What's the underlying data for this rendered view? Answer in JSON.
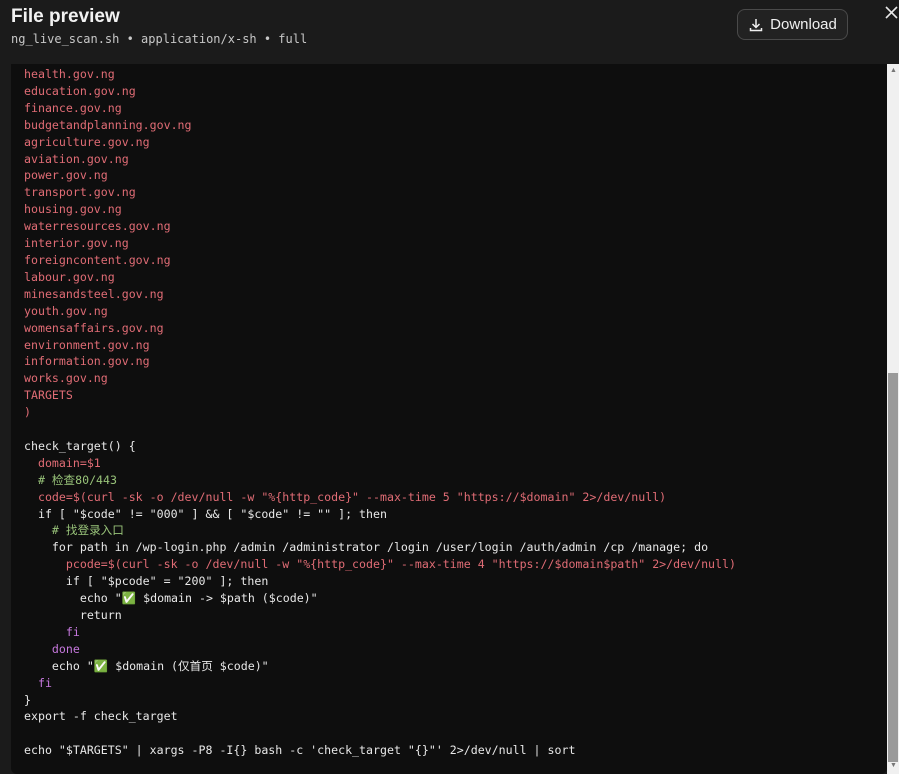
{
  "header": {
    "title": "File preview",
    "subtitle": "ng_live_scan.sh • application/x-sh • full",
    "download_label": "Download",
    "download_icon": "download-icon",
    "close_icon": "close-icon"
  },
  "code": {
    "language": "bash",
    "lines": [
      "health.gov.ng",
      "education.gov.ng",
      "finance.gov.ng",
      "budgetandplanning.gov.ng",
      "agriculture.gov.ng",
      "aviation.gov.ng",
      "power.gov.ng",
      "transport.gov.ng",
      "housing.gov.ng",
      "waterresources.gov.ng",
      "interior.gov.ng",
      "foreigncontent.gov.ng",
      "labour.gov.ng",
      "minesandsteel.gov.ng",
      "youth.gov.ng",
      "womensaffairs.gov.ng",
      "environment.gov.ng",
      "information.gov.ng",
      "works.gov.ng",
      "TARGETS",
      ")",
      "",
      "check_target() {",
      "  domain=$1",
      "  # 检查80/443",
      "  code=$(curl -sk -o /dev/null -w \"%{http_code}\" --max-time 5 \"https://$domain\" 2>/dev/null)",
      "  if [ \"$code\" != \"000\" ] && [ \"$code\" != \"\" ]; then",
      "    # 找登录入口",
      "    for path in /wp-login.php /admin /administrator /login /user/login /auth/admin /cp /manage; do",
      "      pcode=$(curl -sk -o /dev/null -w \"%{http_code}\" --max-time 4 \"https://$domain$path\" 2>/dev/null)",
      "      if [ \"$pcode\" = \"200\" ]; then",
      "        echo \"✅ $domain -> $path ($code)\"",
      "        return",
      "      fi",
      "    done",
      "    echo \"✅ $domain (仅首页 $code)\"",
      "  fi",
      "}",
      "export -f check_target",
      "",
      "echo \"$TARGETS\" | xargs -P8 -I{} bash -c 'check_target \"{}\"' 2>/dev/null | sort"
    ]
  },
  "colors": {
    "background": "#1b1b1b",
    "code_background": "#0e0e0e",
    "string": "#e06c75",
    "keyword": "#c678dd",
    "comment": "#98c379"
  }
}
